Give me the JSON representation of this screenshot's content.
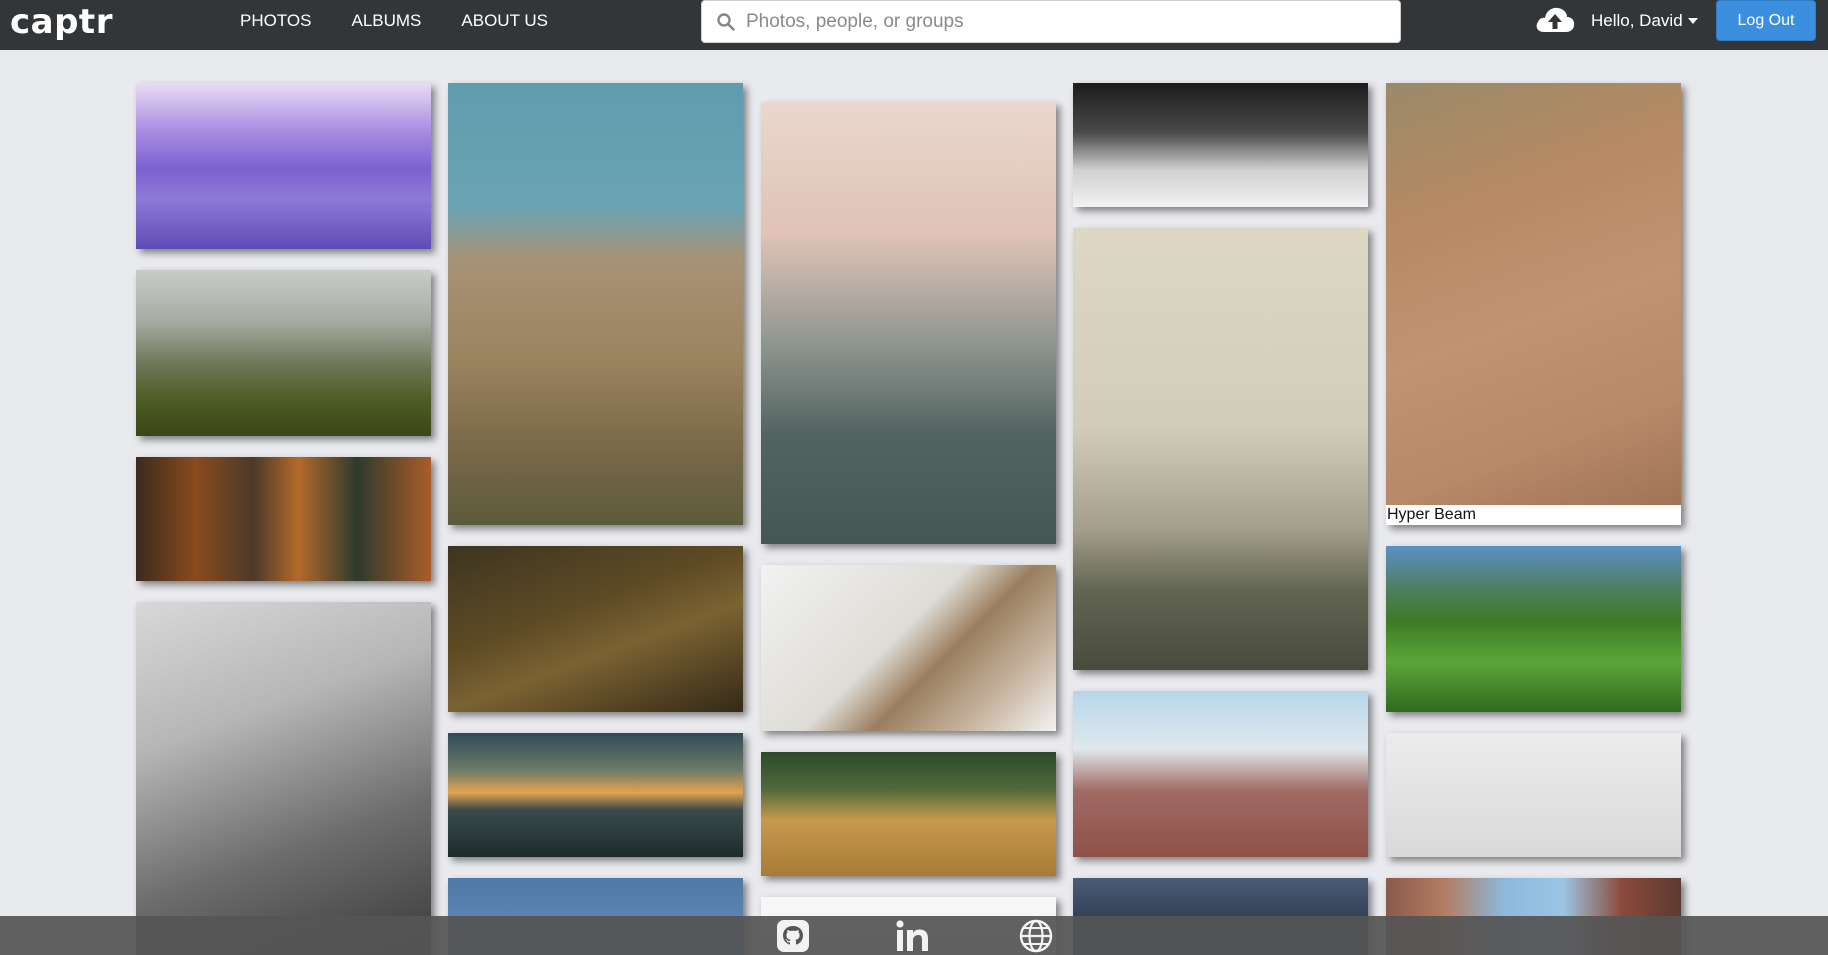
{
  "app": {
    "logo": "captr"
  },
  "nav": {
    "links": [
      {
        "label": "PHOTOS"
      },
      {
        "label": "ALBUMS"
      },
      {
        "label": "ABOUT US"
      }
    ]
  },
  "search": {
    "placeholder": "Photos, people, or groups",
    "value": ""
  },
  "user": {
    "greeting": "Hello, David",
    "logout_label": "Log Out",
    "upload_icon": "cloud-upload-icon"
  },
  "gallery": {
    "tiles": [
      {
        "name": "purple-bay-bridge-photo",
        "caption": "",
        "bg": "linear-gradient(180deg,#e9dcf5 0%,#a68ae0 30%,#7b62d0 52%,#8d7ad6 70%,#5f4bb6 100%)"
      },
      {
        "name": "foggy-meadow-tree-photo",
        "caption": "",
        "bg": "linear-gradient(180deg,#c9ccc7 0%,#a8aca4 30%,#6d7456 58%,#4e5d24 78%,#3a4617 100%)"
      },
      {
        "name": "autumn-leaves-photo",
        "caption": "",
        "bg": "linear-gradient(90deg,#3b2b1e 0%,#8a4a1d 20%,#4c3a2a 40%,#b46a2a 55%,#2e3a2c 75%,#a95d2b 100%)"
      },
      {
        "name": "wagon-wheel-bw-photo",
        "caption": "",
        "bg": "linear-gradient(160deg,#d8d8d8 0%,#b6b6b6 30%,#6d6d6d 60%,#2c2c2c 100%)"
      },
      {
        "name": "highway-interchange-aerial-photo",
        "caption": "",
        "bg": "linear-gradient(180deg,#5f9cae 0%,#6aa4b3 28%,#a79275 40%,#9c8460 62%,#7d6c4a 80%,#5d5a3c 100%)"
      },
      {
        "name": "fawn-deer-photo",
        "caption": "",
        "bg": "linear-gradient(160deg,#3d3520 0%,#5e4b25 40%,#7b6232 60%,#342a17 100%)"
      },
      {
        "name": "mountain-sunset-photo",
        "caption": "",
        "bg": "linear-gradient(180deg,#2f4a57 0%,#6d7a6a 30%,#e2a44f 48%,#3b4a4b 62%,#1c2b2a 100%)"
      },
      {
        "name": "blue-sky-photo",
        "caption": "",
        "bg": "linear-gradient(180deg,#4f79a9 0%,#7896b9 100%)"
      },
      {
        "name": "snowy-fir-tree-photo",
        "caption": "",
        "bg": "linear-gradient(180deg,#ead7cd 0%,#dfc3b6 30%,#8e9590 55%,#536460 75%,#455654 100%)"
      },
      {
        "name": "brooklyn-bridge-photo",
        "caption": "",
        "bg": "linear-gradient(135deg,#f2f2f2 0%,#dedcd6 45%,#9a7e5e 60%,#c7b5a0 80%,#f3f3f3 100%)"
      },
      {
        "name": "golden-wheat-photo",
        "caption": "",
        "bg": "linear-gradient(180deg,#2c4a2a 0%,#4f6a3a 30%,#c79a4e 55%,#a87a35 100%)"
      },
      {
        "name": "white-minimal-photo",
        "caption": "",
        "bg": "linear-gradient(180deg,#f7f7f7 0%,#ececec 100%)"
      },
      {
        "name": "steel-tower-photo",
        "caption": "",
        "bg": "linear-gradient(180deg,#1c1c1c 0%,#4a4a4a 40%,#cfcfcf 70%,#f3f3f3 100%)"
      },
      {
        "name": "misty-hill-photo",
        "caption": "",
        "bg": "linear-gradient(180deg,#dcd8c4 0%,#d2cdb8 45%,#a49f8a 68%,#626553 82%,#474b3d 100%)"
      },
      {
        "name": "desert-woman-photo",
        "caption": "",
        "bg": "linear-gradient(180deg,#b7d6ea 0%,#dfe8ec 35%,#a06b63 60%,#8e5149 100%)"
      },
      {
        "name": "grapes-in-hands-photo",
        "caption": "",
        "bg": "linear-gradient(180deg,#4a5c75 0%,#263248 50%,#1b2233 100%)"
      },
      {
        "name": "leopard-on-trail-photo",
        "caption": "Hyper Beam",
        "bg": "linear-gradient(160deg,#9a8a68 0%,#b88a63 30%,#c19373 55%,#b88868 80%,#9f7457 100%)"
      },
      {
        "name": "green-grass-photo",
        "caption": "",
        "bg": "linear-gradient(180deg,#5b8fc5 0%,#4f7f63 25%,#3d7a24 45%,#5aa639 70%,#2f6a1c 100%)"
      },
      {
        "name": "light-grey-photo",
        "caption": "",
        "bg": "linear-gradient(180deg,#ececec 0%,#d9d9d9 100%)"
      },
      {
        "name": "city-street-photo",
        "caption": "",
        "bg": "linear-gradient(90deg,#8a5a4a 0%,#b47d62 20%,#8cb9dc 40%,#9cc5e4 60%,#8a4a3a 80%,#5e3a30 100%)"
      }
    ]
  },
  "footer": {
    "icons": [
      "github-icon",
      "linkedin-icon",
      "globe-icon"
    ]
  }
}
